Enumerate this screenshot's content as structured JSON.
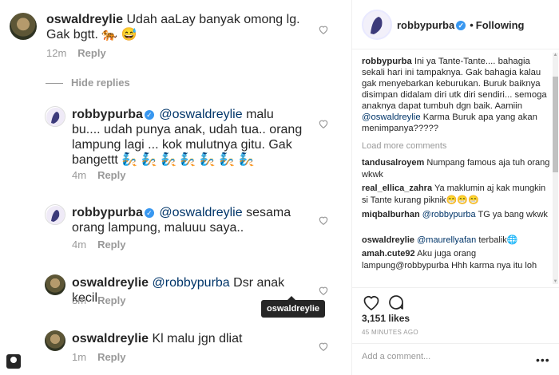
{
  "thread": {
    "hide_replies": "Hide replies",
    "tooltip": "oswaldreylie",
    "comments": [
      {
        "user": "oswaldreylie",
        "text": "Udah aaLay banyak omong lg. Gak bgtt. 🐅 😅",
        "time": "12m",
        "reply": "Reply"
      },
      {
        "user": "robbypurba",
        "verified": true,
        "mention": "@oswaldreylie",
        "text": "malu bu.... udah punya anak, udah tua.. orang lampung lagi ... kok mulutnya gitu. Gak bangettt 🧞 🧞 🧞 🧞 🧞 🧞 🧞",
        "time": "4m",
        "reply": "Reply"
      },
      {
        "user": "robbypurba",
        "verified": true,
        "mention": "@oswaldreylie",
        "text": "sesama orang lampung, maluuu saya..",
        "time": "4m",
        "reply": "Reply"
      },
      {
        "user": "oswaldreylie",
        "mention": "@robbypurba",
        "text": "Dsr anak kecil",
        "time": "3m",
        "reply": "Reply"
      },
      {
        "user": "oswaldreylie",
        "text": "Kl malu jgn dliat",
        "time": "1m",
        "reply": "Reply"
      }
    ]
  },
  "post": {
    "username": "robbypurba",
    "follow_label": "Following",
    "caption_user": "robbypurba",
    "caption_text": "Ini ya Tante-Tante.... bahagia sekali hari ini tampaknya. Gak bahagia kalau gak menyebarkan keburukan. Buruk baiknya disimpan didalam diri utk diri sendiri... semoga anaknya dapat tumbuh dgn baik. Aamiin",
    "caption_mention": "@oswaldreylie",
    "caption_tail": "Karma Buruk apa yang akan menimpanya?????",
    "load_more": "Load more comments",
    "comments": [
      {
        "user": "tandusalroyem",
        "text": "Numpang famous aja tuh orang wkwk"
      },
      {
        "user": "real_ellica_zahra",
        "text": "Ya maklumin aj kak mungkin si Tante kurang piknik😁😁😁"
      },
      {
        "user": "miqbalburhan",
        "mention": "@robbypurba",
        "text": "TG ya bang wkwk"
      },
      {
        "user": "oswaldreylie",
        "mention": "@maurellyafan",
        "text": "terbalik🌐"
      },
      {
        "user": "amah.cute92",
        "text": "Aku juga orang lampung@robbypurba Hhh karma nya itu loh"
      }
    ],
    "likes": "3,151 likes",
    "time_ago": "45 MINUTES AGO",
    "add_comment_placeholder": "Add a comment...",
    "more_dots": "•••"
  }
}
